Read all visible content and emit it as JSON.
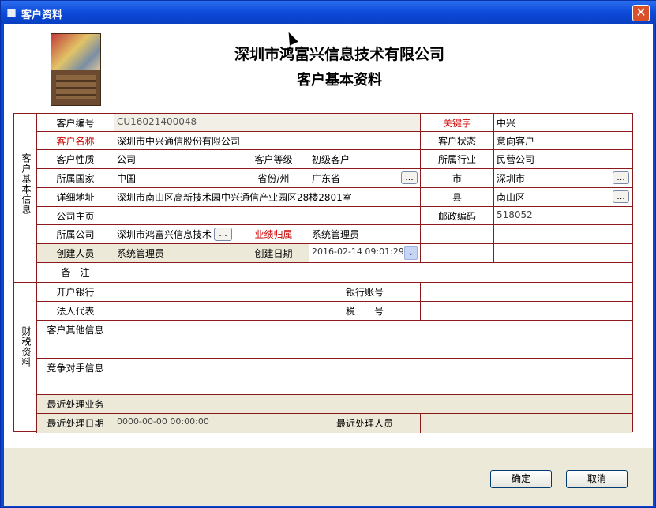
{
  "window": {
    "title": "客户资料",
    "close_glyph": "✕"
  },
  "header": {
    "company": "深圳市鸿富兴信息技术有限公司",
    "subtitle": "客户基本资料"
  },
  "sections": {
    "basic": "客户基本信息",
    "finance": "财税资料"
  },
  "labels": {
    "customer_no": "客户编号",
    "keyword": "关键字",
    "customer_name": "客户名称",
    "customer_status": "客户状态",
    "customer_nature": "客户性质",
    "customer_level": "客户等级",
    "industry": "所属行业",
    "country": "所属国家",
    "province": "省份/州",
    "city": "市",
    "address": "详细地址",
    "county": "县",
    "homepage": "公司主页",
    "postcode": "邮政编码",
    "company": "所属公司",
    "owner": "业绩归属",
    "creator": "创建人员",
    "create_date": "创建日期",
    "remark": "备　注",
    "bank": "开户银行",
    "bank_account": "银行账号",
    "legal_rep": "法人代表",
    "tax_no": "税　　号",
    "other_info": "客户其他信息",
    "competitor": "竞争对手信息",
    "last_business": "最近处理业务",
    "last_date": "最近处理日期",
    "last_handler": "最近处理人员"
  },
  "values": {
    "customer_no": "CU16021400048",
    "keyword": "中兴",
    "customer_name": "深圳市中兴通信股份有限公司",
    "customer_status": "意向客户",
    "customer_nature": "公司",
    "customer_level": "初级客户",
    "industry": "民营公司",
    "country": "中国",
    "province": "广东省",
    "city": "深圳市",
    "address": "深圳市南山区高新技术园中兴通信产业园区28楼2801室",
    "county": "南山区",
    "homepage": "",
    "postcode": "518052",
    "company": "深圳市鸿富兴信息技术",
    "owner": "系统管理员",
    "creator": "系统管理员",
    "create_date": "2016-02-14 09:01:29",
    "last_date": "0000-00-00 00:00:00"
  },
  "buttons": {
    "ellipsis": "...",
    "ok": "确定",
    "cancel": "取消",
    "dropdown": "⌄"
  },
  "colors": {
    "titlebar": "#0c4ad9",
    "border": "#8b1a1a",
    "required_label": "#cc0000",
    "footer": "#ece9d8"
  }
}
